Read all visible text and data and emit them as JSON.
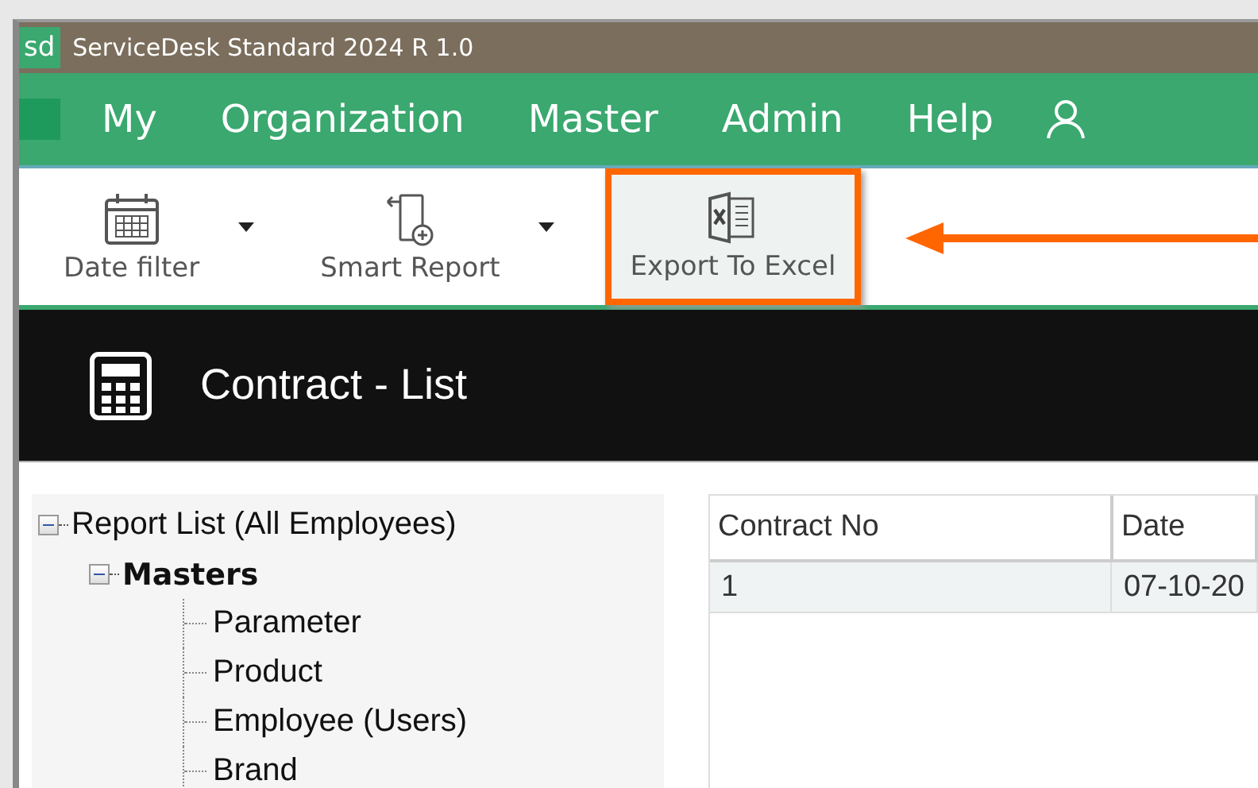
{
  "window": {
    "logo": "sd",
    "title": "ServiceDesk Standard 2024 R 1.0"
  },
  "menu": [
    {
      "label": "My"
    },
    {
      "label": "Organization"
    },
    {
      "label": "Master"
    },
    {
      "label": "Admin"
    },
    {
      "label": "Help"
    }
  ],
  "toolbar": [
    {
      "label": "Date filter",
      "kind": "calendar",
      "dropdown": true,
      "highlighted": false
    },
    {
      "label": "Smart Report",
      "kind": "report",
      "dropdown": true,
      "highlighted": false
    },
    {
      "label": "Export To Excel",
      "kind": "excel",
      "dropdown": false,
      "highlighted": true
    }
  ],
  "page_title": "Contract - List",
  "tree": [
    {
      "label": "Report List (All Employees)",
      "expanded": true,
      "children": [
        {
          "label": "Masters",
          "expanded": true,
          "children": [
            {
              "label": "Parameter"
            },
            {
              "label": "Product"
            },
            {
              "label": "Employee (Users)"
            },
            {
              "label": "Brand"
            }
          ]
        }
      ]
    }
  ],
  "table": {
    "columns": [
      "Contract No",
      "Date"
    ],
    "rows": [
      [
        "1",
        "07-10-20"
      ]
    ]
  }
}
